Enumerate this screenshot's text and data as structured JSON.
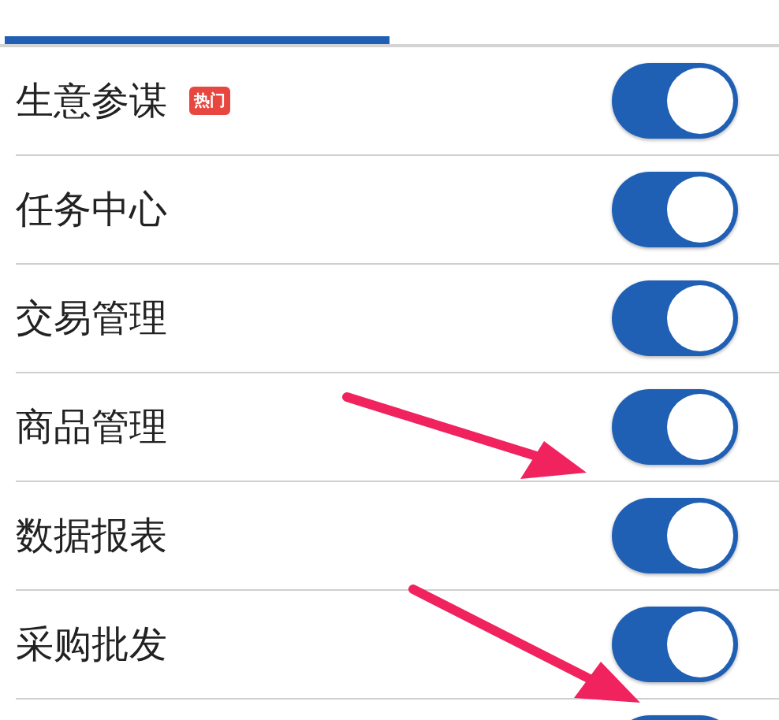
{
  "tabs": [
    {
      "selected": true
    },
    {
      "selected": false
    }
  ],
  "items": [
    {
      "label": "生意参谋",
      "badge": "热门",
      "on": true
    },
    {
      "label": "任务中心",
      "on": true
    },
    {
      "label": "交易管理",
      "on": true
    },
    {
      "label": "商品管理",
      "on": true
    },
    {
      "label": "数据报表",
      "on": true
    },
    {
      "label": "采购批发",
      "on": true
    },
    {
      "on": true
    }
  ]
}
